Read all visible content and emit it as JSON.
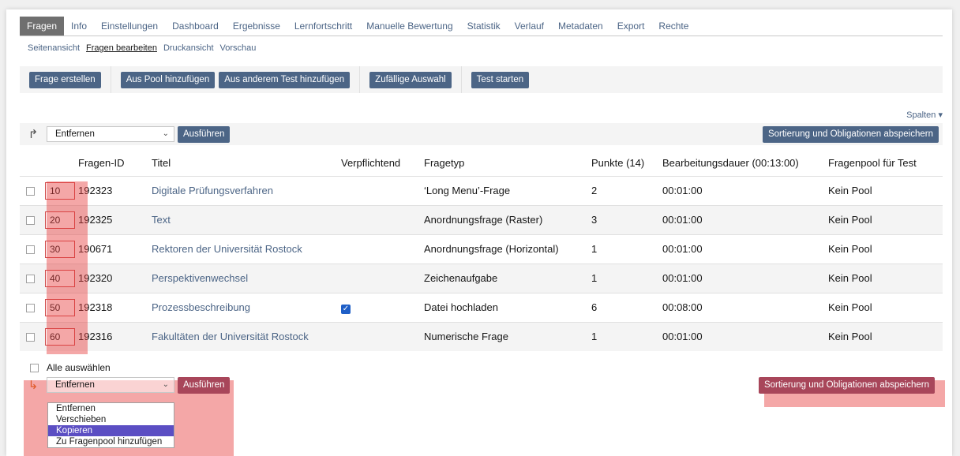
{
  "tabs": [
    "Fragen",
    "Info",
    "Einstellungen",
    "Dashboard",
    "Ergebnisse",
    "Lernfortschritt",
    "Manuelle Bewertung",
    "Statistik",
    "Verlauf",
    "Metadaten",
    "Export",
    "Rechte"
  ],
  "subtabs": [
    "Seitenansicht",
    "Fragen bearbeiten",
    "Druckansicht",
    "Vorschau"
  ],
  "toolbar": {
    "create": "Frage erstellen",
    "from_pool": "Aus Pool hinzufügen",
    "from_test": "Aus anderem Test hinzufügen",
    "random": "Zufällige Auswahl",
    "start": "Test starten"
  },
  "spalten": "Spalten ▾",
  "action": {
    "select_value": "Entfernen",
    "execute": "Ausführen",
    "save": "Sortierung und Obligationen abspeichern"
  },
  "table": {
    "headers": [
      "Fragen-ID",
      "Titel",
      "Verpflichtend",
      "Fragetyp",
      "Punkte (14)",
      "Bearbeitungsdauer (00:13:00)",
      "Fragenpool für Test"
    ],
    "rows": [
      {
        "order": "10",
        "id": "192323",
        "title": "Digitale Prüfungsverfahren",
        "obligatory": false,
        "type": "‘Long Menu’-Frage",
        "points": "2",
        "duration": "00:01:00",
        "pool": "Kein Pool"
      },
      {
        "order": "20",
        "id": "192325",
        "title": "Text",
        "obligatory": false,
        "type": "Anordnungsfrage (Raster)",
        "points": "3",
        "duration": "00:01:00",
        "pool": "Kein Pool"
      },
      {
        "order": "30",
        "id": "190671",
        "title": "Rektoren der Universität Rostock",
        "obligatory": false,
        "type": "Anordnungsfrage (Horizontal)",
        "points": "1",
        "duration": "00:01:00",
        "pool": "Kein Pool"
      },
      {
        "order": "40",
        "id": "192320",
        "title": "Perspektivenwechsel",
        "obligatory": false,
        "type": "Zeichenaufgabe",
        "points": "1",
        "duration": "00:01:00",
        "pool": "Kein Pool"
      },
      {
        "order": "50",
        "id": "192318",
        "title": "Prozessbeschreibung",
        "obligatory": true,
        "type": "Datei hochladen",
        "points": "6",
        "duration": "00:08:00",
        "pool": "Kein Pool"
      },
      {
        "order": "60",
        "id": "192316",
        "title": "Fakultäten der Universität Rostock",
        "obligatory": false,
        "type": "Numerische Frage",
        "points": "1",
        "duration": "00:01:00",
        "pool": "Kein Pool"
      }
    ]
  },
  "select_all": "Alle auswählen",
  "dropdown_options": [
    "Entfernen",
    "Verschieben",
    "Kopieren",
    "Zu Fragenpool hinzufügen"
  ],
  "dropdown_selected": "Kopieren",
  "colors": {
    "accent": "#4c6586",
    "highlight": "#e63c3c"
  }
}
